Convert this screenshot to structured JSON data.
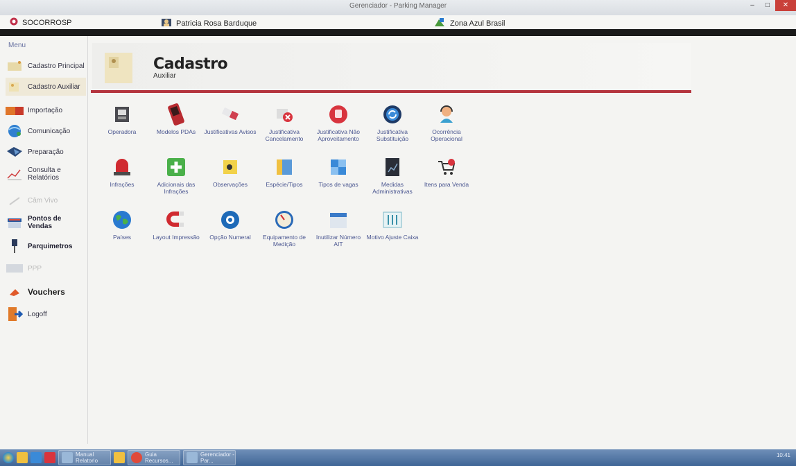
{
  "window": {
    "title": "Gerenciador - Parking Manager",
    "controls": {
      "minimize": "–",
      "maximize": "□",
      "close": "✕"
    }
  },
  "header": {
    "brand": "SOCORROSP",
    "user": "Patricia Rosa Barduque",
    "zone": "Zona Azul Brasil"
  },
  "sidebar": {
    "menu_label": "Menu",
    "items": [
      {
        "label": "Cadastro Principal",
        "icon": "folder-person-icon"
      },
      {
        "label": "Cadastro Auxiliar",
        "icon": "folder-icon"
      },
      {
        "label": "Importação",
        "icon": "import-icon"
      },
      {
        "label": "Comunicação",
        "icon": "globe-network-icon"
      },
      {
        "label": "Preparação",
        "icon": "prepare-device-icon"
      },
      {
        "label": "Consulta e Relatórios",
        "icon": "chart-report-icon"
      },
      {
        "label": "Câm Vivo",
        "icon": "camera-icon"
      },
      {
        "label": "Pontos de Vendas",
        "icon": "store-icon"
      },
      {
        "label": "Parquimetros",
        "icon": "parking-meter-icon"
      },
      {
        "label": "PPP",
        "icon": "ppp-icon"
      },
      {
        "label": "Vouchers",
        "icon": "voucher-icon"
      },
      {
        "label": "Logoff",
        "icon": "logoff-door-icon"
      }
    ]
  },
  "page": {
    "title": "Cadastro",
    "subtitle": "Auxiliar"
  },
  "tiles": [
    {
      "label": "Operadora",
      "icon": "operator-icon"
    },
    {
      "label": "Modelos PDAs",
      "icon": "pda-icon"
    },
    {
      "label": "Justificativas Avisos",
      "icon": "eraser-icon"
    },
    {
      "label": "Justificativa Cancelamento",
      "icon": "cancel-icon"
    },
    {
      "label": "Justificativa Não Aproveitamento",
      "icon": "stop-hand-icon"
    },
    {
      "label": "Justificativa Substituição",
      "icon": "refresh-circle-icon"
    },
    {
      "label": "Ocorrência Operacional",
      "icon": "support-agent-icon"
    },
    {
      "label": "Infrações",
      "icon": "siren-icon"
    },
    {
      "label": "Adicionais das Infrações",
      "icon": "plus-icon"
    },
    {
      "label": "Observações",
      "icon": "note-icon"
    },
    {
      "label": "Espécie/Tipos",
      "icon": "folders-icon"
    },
    {
      "label": "Tipos de vagas",
      "icon": "puzzle-icon"
    },
    {
      "label": "Medidas Administrativas",
      "icon": "document-chart-icon"
    },
    {
      "label": "Itens para Venda",
      "icon": "cart-icon"
    },
    {
      "label": "Países",
      "icon": "world-icon"
    },
    {
      "label": "Layout Impressão",
      "icon": "magnet-icon"
    },
    {
      "label": "Opção Numeral",
      "icon": "number-cloud-icon"
    },
    {
      "label": "Equipamento de Medição",
      "icon": "gauge-icon"
    },
    {
      "label": "Inutilizar Número AIT",
      "icon": "calendar-icon"
    },
    {
      "label": "Motivo Ajuste Caixa",
      "icon": "tools-icon"
    }
  ],
  "taskbar": {
    "tasks": [
      "Manual Relatorio",
      "Guia Recursos...",
      "Gerenciador - Par..."
    ],
    "clock": "10:41"
  },
  "colors": {
    "accent_red": "#b4343e",
    "link_blue": "#4a5690",
    "dark_band": "#1a1a1a"
  }
}
